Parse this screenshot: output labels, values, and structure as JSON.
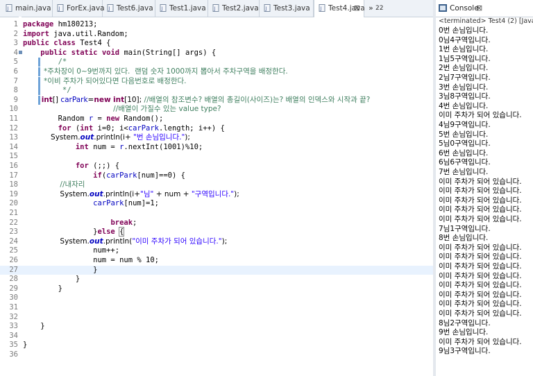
{
  "editor": {
    "tabs": [
      {
        "label": "main.java"
      },
      {
        "label": "ForEx.java"
      },
      {
        "label": "Test6.java"
      },
      {
        "label": "Test1.java"
      },
      {
        "label": "Test2.java"
      },
      {
        "label": "Test3.java"
      },
      {
        "label": "Test4.java",
        "active": true,
        "close": "⊠"
      }
    ],
    "overflow": {
      "chevron": "»",
      "count": "22"
    },
    "lines": [
      {
        "n": "1",
        "segs": [
          {
            "t": "package",
            "c": "kw"
          },
          {
            "t": " hm180213;"
          }
        ]
      },
      {
        "n": "2",
        "segs": [
          {
            "t": "import",
            "c": "kw"
          },
          {
            "t": " java.util.Random;"
          }
        ]
      },
      {
        "n": "3",
        "segs": [
          {
            "t": "public",
            "c": "kw"
          },
          {
            "t": " "
          },
          {
            "t": "class",
            "c": "kw"
          },
          {
            "t": " Test4 {"
          }
        ]
      },
      {
        "n": "4",
        "segs": [
          {
            "t": "    "
          },
          {
            "t": "public",
            "c": "kw"
          },
          {
            "t": " "
          },
          {
            "t": "static",
            "c": "kw"
          },
          {
            "t": " "
          },
          {
            "t": "void",
            "c": "kw"
          },
          {
            "t": " main(String[] args) {"
          }
        ]
      },
      {
        "n": "5",
        "segs": [
          {
            "t": "        /*",
            "c": "cm"
          }
        ]
      },
      {
        "n": "6",
        "segs": [
          {
            "t": "         *주차장이 0~9번까지 있다.  랜덤 숫자 1000까지 뽑아서 주차구역을 배정한다.",
            "c": "cm"
          }
        ],
        "kr": true
      },
      {
        "n": "7",
        "segs": [
          {
            "t": "         *이비 주차가 되어있다면 다음번호로 배정한다.",
            "c": "cm"
          }
        ],
        "kr": true
      },
      {
        "n": "8",
        "segs": [
          {
            "t": "         */",
            "c": "cm"
          }
        ]
      },
      {
        "n": "9",
        "segs": [
          {
            "t": "        "
          },
          {
            "t": "int",
            "c": "kw"
          },
          {
            "t": "[] "
          },
          {
            "t": "carPark",
            "c": "fld"
          },
          {
            "t": "="
          },
          {
            "t": "new",
            "c": "kw"
          },
          {
            "t": " "
          },
          {
            "t": "int",
            "c": "kw"
          },
          {
            "t": "[10]; "
          },
          {
            "t": "//배열의 참조변수? 배열의 총길이(사이즈)는? 배열의 인덱스와 시작과 끝?",
            "c": "cm"
          }
        ],
        "kr": true
      },
      {
        "n": "10",
        "segs": [
          {
            "t": "                                       //배열이 가질수 있는 value type?",
            "c": "cm"
          }
        ],
        "kr": true
      },
      {
        "n": "11",
        "segs": [
          {
            "t": "        Random "
          },
          {
            "t": "r",
            "c": "fld"
          },
          {
            "t": " = "
          },
          {
            "t": "new",
            "c": "kw"
          },
          {
            "t": " Random();"
          }
        ]
      },
      {
        "n": "12",
        "segs": [
          {
            "t": "        "
          },
          {
            "t": "for",
            "c": "kw"
          },
          {
            "t": " ("
          },
          {
            "t": "int",
            "c": "kw"
          },
          {
            "t": " i=0; i<"
          },
          {
            "t": "carPark",
            "c": "fld"
          },
          {
            "t": ".length; i++) {"
          }
        ]
      },
      {
        "n": "13",
        "segs": [
          {
            "t": "            System."
          },
          {
            "t": "out",
            "c": "sfld"
          },
          {
            "t": ".println(i+ "
          },
          {
            "t": "\"번 손님입니다.\"",
            "c": "str"
          },
          {
            "t": ");"
          }
        ],
        "kr": true
      },
      {
        "n": "14",
        "segs": [
          {
            "t": "            "
          },
          {
            "t": "int",
            "c": "kw"
          },
          {
            "t": " num = "
          },
          {
            "t": "r",
            "c": "fld"
          },
          {
            "t": ".nextInt(1001)%10;"
          }
        ]
      },
      {
        "n": "15",
        "segs": [
          {
            "t": ""
          }
        ]
      },
      {
        "n": "16",
        "segs": [
          {
            "t": "            "
          },
          {
            "t": "for",
            "c": "kw"
          },
          {
            "t": " (;;) {"
          }
        ]
      },
      {
        "n": "17",
        "segs": [
          {
            "t": "                "
          },
          {
            "t": "if",
            "c": "kw"
          },
          {
            "t": "("
          },
          {
            "t": "carPark",
            "c": "fld"
          },
          {
            "t": "[num]==0) {"
          }
        ]
      },
      {
        "n": "18",
        "segs": [
          {
            "t": "                "
          },
          {
            "t": "//내자리",
            "c": "cm"
          }
        ],
        "kr": true
      },
      {
        "n": "19",
        "segs": [
          {
            "t": "                System."
          },
          {
            "t": "out",
            "c": "sfld"
          },
          {
            "t": ".println(i+"
          },
          {
            "t": "\"님\"",
            "c": "str"
          },
          {
            "t": " + num + "
          },
          {
            "t": "\"구역입니다.\"",
            "c": "str"
          },
          {
            "t": ");"
          }
        ],
        "kr": true
      },
      {
        "n": "20",
        "segs": [
          {
            "t": "                "
          },
          {
            "t": "carPark",
            "c": "fld"
          },
          {
            "t": "[num]=1;"
          }
        ]
      },
      {
        "n": "21",
        "segs": [
          {
            "t": ""
          }
        ]
      },
      {
        "n": "22",
        "segs": [
          {
            "t": "                    "
          },
          {
            "t": "break",
            "c": "kw"
          },
          {
            "t": ";"
          }
        ]
      },
      {
        "n": "23",
        "segs": [
          {
            "t": "                }"
          },
          {
            "t": "else",
            "c": "kw"
          },
          {
            "t": " "
          },
          {
            "t": "{",
            "c": "bracket"
          }
        ]
      },
      {
        "n": "24",
        "segs": [
          {
            "t": "                System."
          },
          {
            "t": "out",
            "c": "sfld"
          },
          {
            "t": ".println("
          },
          {
            "t": "\"이미 주차가 되어 있습니다.\"",
            "c": "str"
          },
          {
            "t": ");"
          }
        ],
        "kr": true
      },
      {
        "n": "25",
        "segs": [
          {
            "t": "                num++;"
          }
        ]
      },
      {
        "n": "26",
        "segs": [
          {
            "t": "                num = num % 10;"
          }
        ]
      },
      {
        "n": "27",
        "segs": [
          {
            "t": "                }"
          }
        ],
        "current": true
      },
      {
        "n": "28",
        "segs": [
          {
            "t": "            }"
          }
        ]
      },
      {
        "n": "29",
        "segs": [
          {
            "t": "        }"
          }
        ]
      },
      {
        "n": "30",
        "segs": [
          {
            "t": ""
          }
        ]
      },
      {
        "n": "31",
        "segs": [
          {
            "t": ""
          }
        ]
      },
      {
        "n": "32",
        "segs": [
          {
            "t": ""
          }
        ]
      },
      {
        "n": "33",
        "segs": [
          {
            "t": "    }"
          }
        ]
      },
      {
        "n": "34",
        "segs": [
          {
            "t": ""
          }
        ]
      },
      {
        "n": "35",
        "segs": [
          {
            "t": "}"
          }
        ]
      },
      {
        "n": "36",
        "segs": [
          {
            "t": ""
          }
        ]
      }
    ]
  },
  "console": {
    "tab_label": "Console",
    "close": "⊠",
    "status": "<terminated> Test4 (2) [Java Appli",
    "lines": [
      "0번 손님입니다.",
      "0님4구역입니다.",
      "1번 손님입니다.",
      "1님5구역입니다.",
      "2번 손님입니다.",
      "2님7구역입니다.",
      "3번 손님입니다.",
      "3님8구역입니다.",
      "4번 손님입니다.",
      "이미 주차가 되어 있습니다.",
      "4님9구역입니다.",
      "5번 손님입니다.",
      "5님0구역입니다.",
      "6번 손님입니다.",
      "6님6구역입니다.",
      "7번 손님입니다.",
      "이미 주차가 되어 있습니다.",
      "이미 주차가 되어 있습니다.",
      "이미 주차가 되어 있습니다.",
      "이미 주차가 되어 있습니다.",
      "이미 주차가 되어 있습니다.",
      "7님1구역입니다.",
      "8번 손님입니다.",
      "이미 주차가 되어 있습니다.",
      "이미 주차가 되어 있습니다.",
      "이미 주차가 되어 있습니다.",
      "이미 주차가 되어 있습니다.",
      "이미 주차가 되어 있습니다.",
      "이미 주차가 되어 있습니다.",
      "이미 주차가 되어 있습니다.",
      "이미 주차가 되어 있습니다.",
      "8님2구역입니다.",
      "9번 손님입니다.",
      "이미 주차가 되어 있습니다.",
      "9님3구역입니다."
    ]
  },
  "colors": {
    "keyword": "#7f0055",
    "comment": "#3f7f5f",
    "string": "#2a00ff",
    "field": "#0000c0",
    "current_line": "#e8f2fe"
  }
}
